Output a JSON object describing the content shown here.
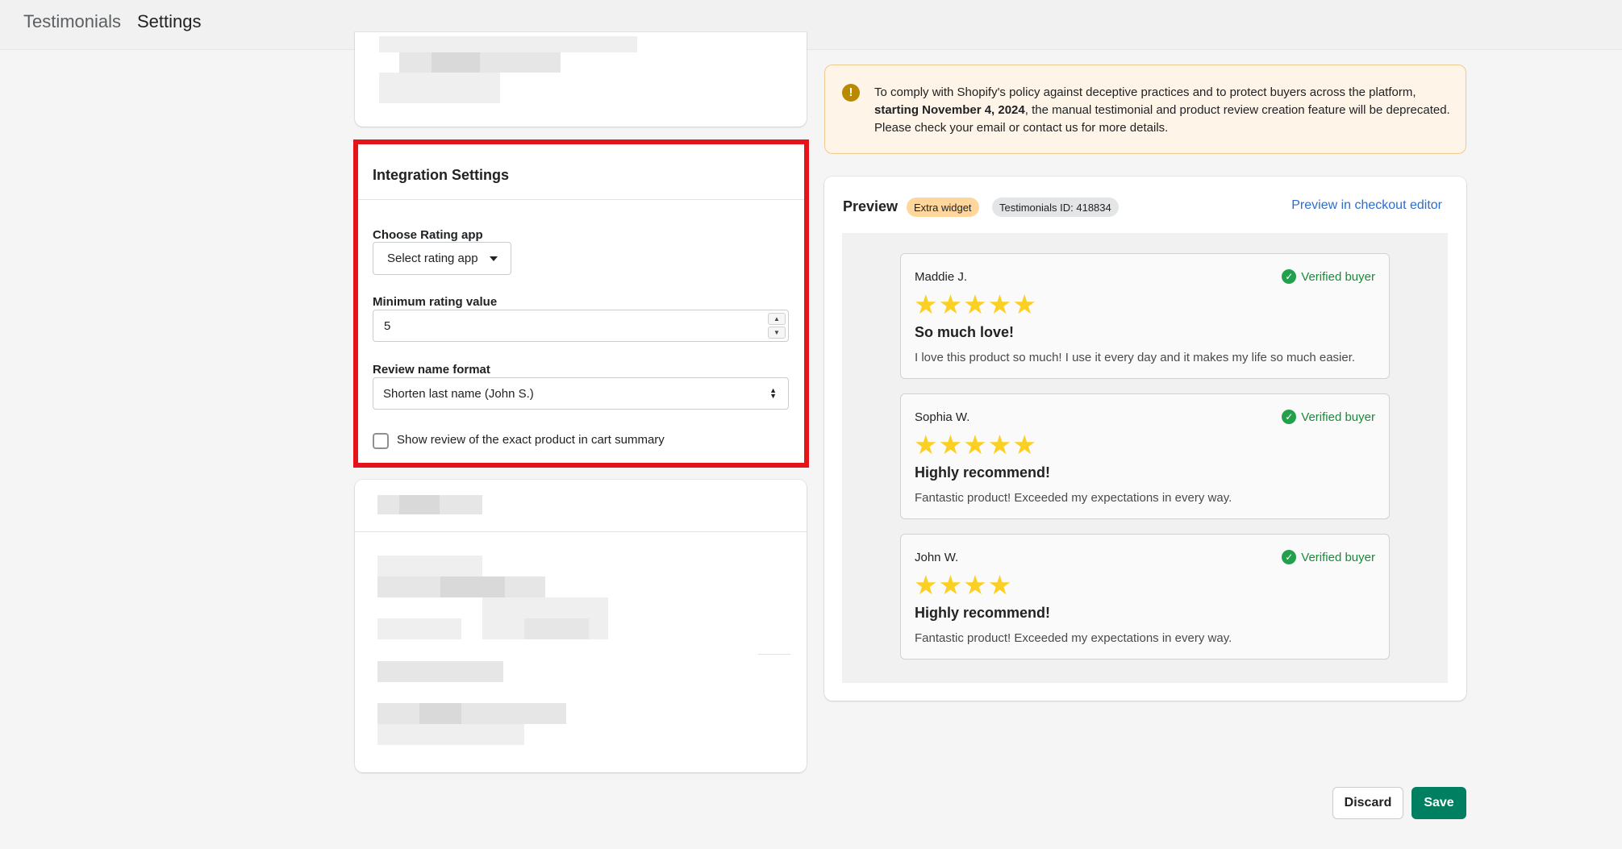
{
  "header": {
    "breadcrumb_parent": "Testimonials",
    "breadcrumb_current": "Settings"
  },
  "integration": {
    "title": "Integration Settings",
    "rating_app_label": "Choose Rating app",
    "rating_app_value": "Select rating app",
    "min_rating_label": "Minimum rating value",
    "min_rating_value": "5",
    "name_format_label": "Review name format",
    "name_format_value": "Shorten last name (John S.)",
    "show_exact_label": "Show review of the exact product in cart summary",
    "show_exact_checked": false
  },
  "banner": {
    "text_before": "To comply with Shopify's policy against deceptive practices and to protect buyers across the platform, ",
    "text_bold": "starting November 4, 2024",
    "text_after": ", the manual testimonial and product review creation feature will be deprecated. Please check your email or contact us for more details.",
    "icon": "warning-icon"
  },
  "preview": {
    "title": "Preview",
    "badge_extra": "Extra widget",
    "badge_id": "Testimonials ID: 418834",
    "link": "Preview in checkout editor",
    "verified_label": "Verified buyer",
    "reviews": [
      {
        "name": "Maddie J.",
        "stars": "★★★★★",
        "title": "So much love!",
        "body": "I love this product so much! I use it every day and it makes my life so much easier."
      },
      {
        "name": "Sophia W.",
        "stars": "★★★★★",
        "title": "Highly recommend!",
        "body": "Fantastic product! Exceeded my expectations in every way."
      },
      {
        "name": "John W.",
        "stars": "★★★★",
        "title": "Highly recommend!",
        "body": "Fantastic product! Exceeded my expectations in every way."
      }
    ]
  },
  "actions": {
    "discard": "Discard",
    "save": "Save",
    "save_color": "#008060"
  }
}
